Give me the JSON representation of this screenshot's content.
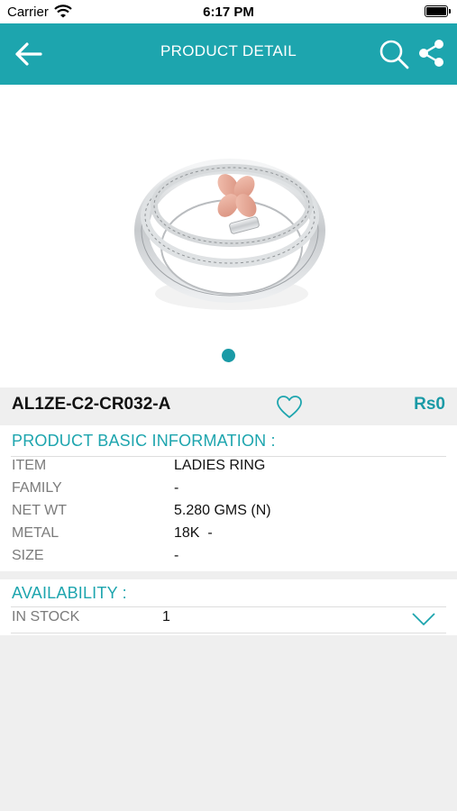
{
  "status": {
    "carrier": "Carrier",
    "time": "6:17 PM"
  },
  "header": {
    "title": "PRODUCT DETAIL"
  },
  "icons": {
    "back": "arrow-left-icon",
    "search": "search-icon",
    "share": "share-icon",
    "wishlist": "heart-icon",
    "expand": "chevron-down-icon"
  },
  "gallery": {
    "page_count": 1,
    "current_page": 1
  },
  "product": {
    "code": "AL1ZE-C2-CR032-A",
    "price": "Rs0"
  },
  "basic_info": {
    "heading": "PRODUCT BASIC INFORMATION :",
    "rows": [
      {
        "label": "ITEM",
        "value": "LADIES RING"
      },
      {
        "label": "FAMILY",
        "value": "-"
      },
      {
        "label": "NET WT",
        "value": "5.280 GMS (N)"
      },
      {
        "label": "METAL",
        "value": "18K  -"
      },
      {
        "label": "SIZE",
        "value": "-"
      }
    ]
  },
  "availability": {
    "heading": "AVAILABILITY :",
    "label": "IN STOCK",
    "value": "1"
  },
  "colors": {
    "accent": "#1da5ae",
    "background": "#efefef",
    "price": "#1a9aa6"
  }
}
